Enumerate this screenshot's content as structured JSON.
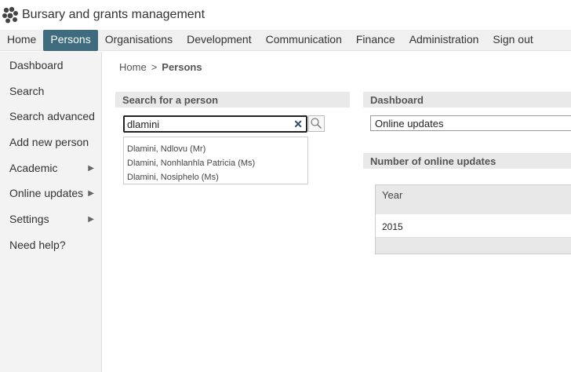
{
  "app": {
    "title": "Bursary and grants management",
    "logo_icon": "paw-logo-icon"
  },
  "topnav": {
    "items": [
      "Home",
      "Persons",
      "Organisations",
      "Development",
      "Communication",
      "Finance",
      "Administration",
      "Sign out"
    ],
    "active": "Persons"
  },
  "sidebar": {
    "items": [
      {
        "label": "Dashboard"
      },
      {
        "label": "Search"
      },
      {
        "label": "Search advanced"
      },
      {
        "label": "Add new person"
      },
      {
        "label": "Academic",
        "arrow": "▶"
      },
      {
        "label": "Online updates",
        "arrow": "▶"
      },
      {
        "label": "Settings",
        "arrow": "▶"
      },
      {
        "label": "Need help?"
      }
    ]
  },
  "breadcrumb": {
    "home": "Home",
    "separator": ">",
    "current": "Persons"
  },
  "search_panel": {
    "title": "Search for a person",
    "query": "dlamini",
    "clear_glyph": "✕",
    "suggestions": [
      "Dlamini, Ndlovu (Mr)",
      "Dlamini, Nonhlanhla Patricia (Ms)",
      "Dlamini, Nosiphelo (Ms)"
    ]
  },
  "dashboard_panel": {
    "title": "Dashboard",
    "selected": "Online updates"
  },
  "updates_panel": {
    "title": "Number of online updates",
    "table": {
      "header": "Year",
      "rows": [
        "2015"
      ]
    }
  },
  "colors": {
    "accent": "#3e6b7e",
    "panel_header": "#e9e9e9",
    "sidebar": "#f3f3f3"
  }
}
